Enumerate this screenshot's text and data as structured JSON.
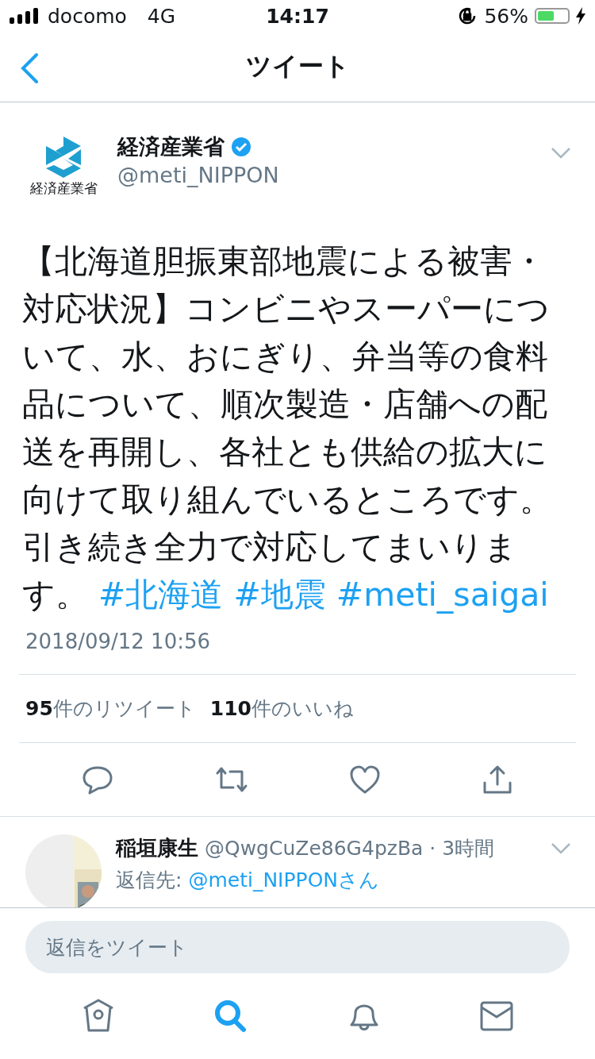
{
  "status_bar": {
    "carrier": "docomo",
    "network": "4G",
    "time": "14:17",
    "battery": "56%"
  },
  "nav": {
    "title": "ツイート"
  },
  "tweet": {
    "logo_text": "経済産業省",
    "name": "経済産業省",
    "verified": true,
    "handle": "@meti_NIPPON",
    "body": "【北海道胆振東部地震による被害・対応状況】コンビニやスーパーについて、水、おにぎり、弁当等の食料品について、順次製造・店舗への配送を再開し、各社とも供給の拡大に向けて取り組んでいるところです。引き続き全力で対応してまいります。",
    "hashtags": [
      "#北海道",
      "#地震",
      "#meti_saigai"
    ],
    "timestamp": "2018/09/12 10:56",
    "stats": [
      "**95**件のリツイート",
      "**110**件のいいね"
    ]
  },
  "reply": {
    "name": "稲垣康生",
    "handle": "@QwgCuZe86G4pzBa",
    "time": "· 3時間",
    "reply_label": "返信先:",
    "reply_to": "@meti_NIPPONさん"
  },
  "composer": {
    "placeholder": "返信をツイート"
  },
  "tab_bar": [
    {
      "kind": "home",
      "selected": false
    },
    {
      "kind": "search",
      "selected": true
    },
    {
      "kind": "notifications",
      "selected": false
    },
    {
      "kind": "messages",
      "selected": false
    }
  ]
}
